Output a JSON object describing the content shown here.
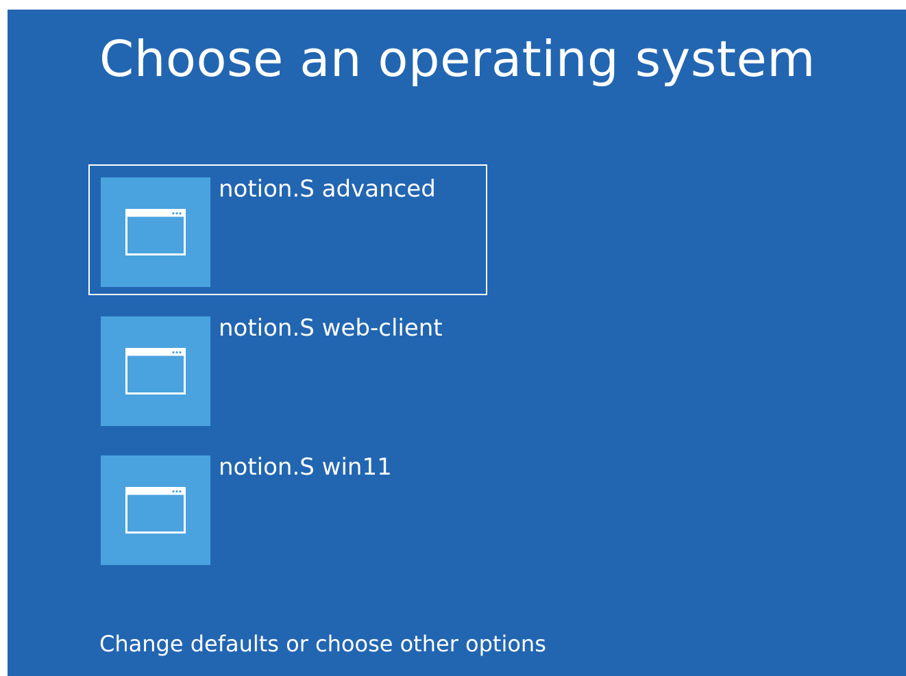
{
  "screen": {
    "title": "Choose an operating system",
    "background_color": "#2266b2",
    "tile_color": "#4aa3df"
  },
  "os_options": [
    {
      "label": "notion.S advanced",
      "icon": "window-icon",
      "selected": true
    },
    {
      "label": "notion.S web-client",
      "icon": "window-icon",
      "selected": false
    },
    {
      "label": "notion.S win11",
      "icon": "window-icon",
      "selected": false
    }
  ],
  "footer": {
    "link_label": "Change defaults or choose other options"
  }
}
